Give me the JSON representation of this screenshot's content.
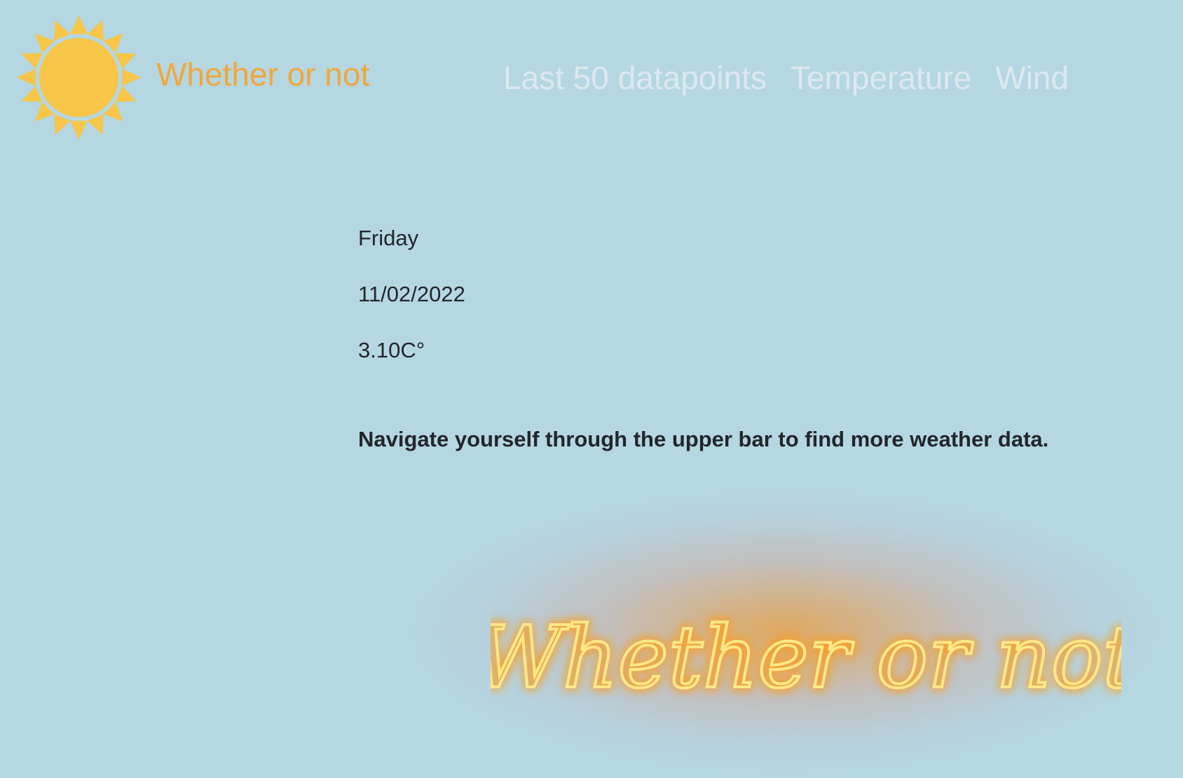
{
  "brand": {
    "name": "Whether or not",
    "icon": "sun-icon",
    "color": "#f0a73a"
  },
  "nav": {
    "links": [
      {
        "label": "Last 50 datapoints"
      },
      {
        "label": "Temperature"
      },
      {
        "label": "Wind"
      }
    ]
  },
  "main": {
    "day": "Friday",
    "date": "11/02/2022",
    "temperature": "3.10C°",
    "hint": "Navigate yourself through the upper bar to find more weather data."
  },
  "banner": {
    "text": "Whether or not",
    "style": "neon-script"
  },
  "colors": {
    "background": "#b5d7e2",
    "accent": "#f0a73a",
    "nav_text": "#dde9ef",
    "sun": "#f7c548"
  }
}
